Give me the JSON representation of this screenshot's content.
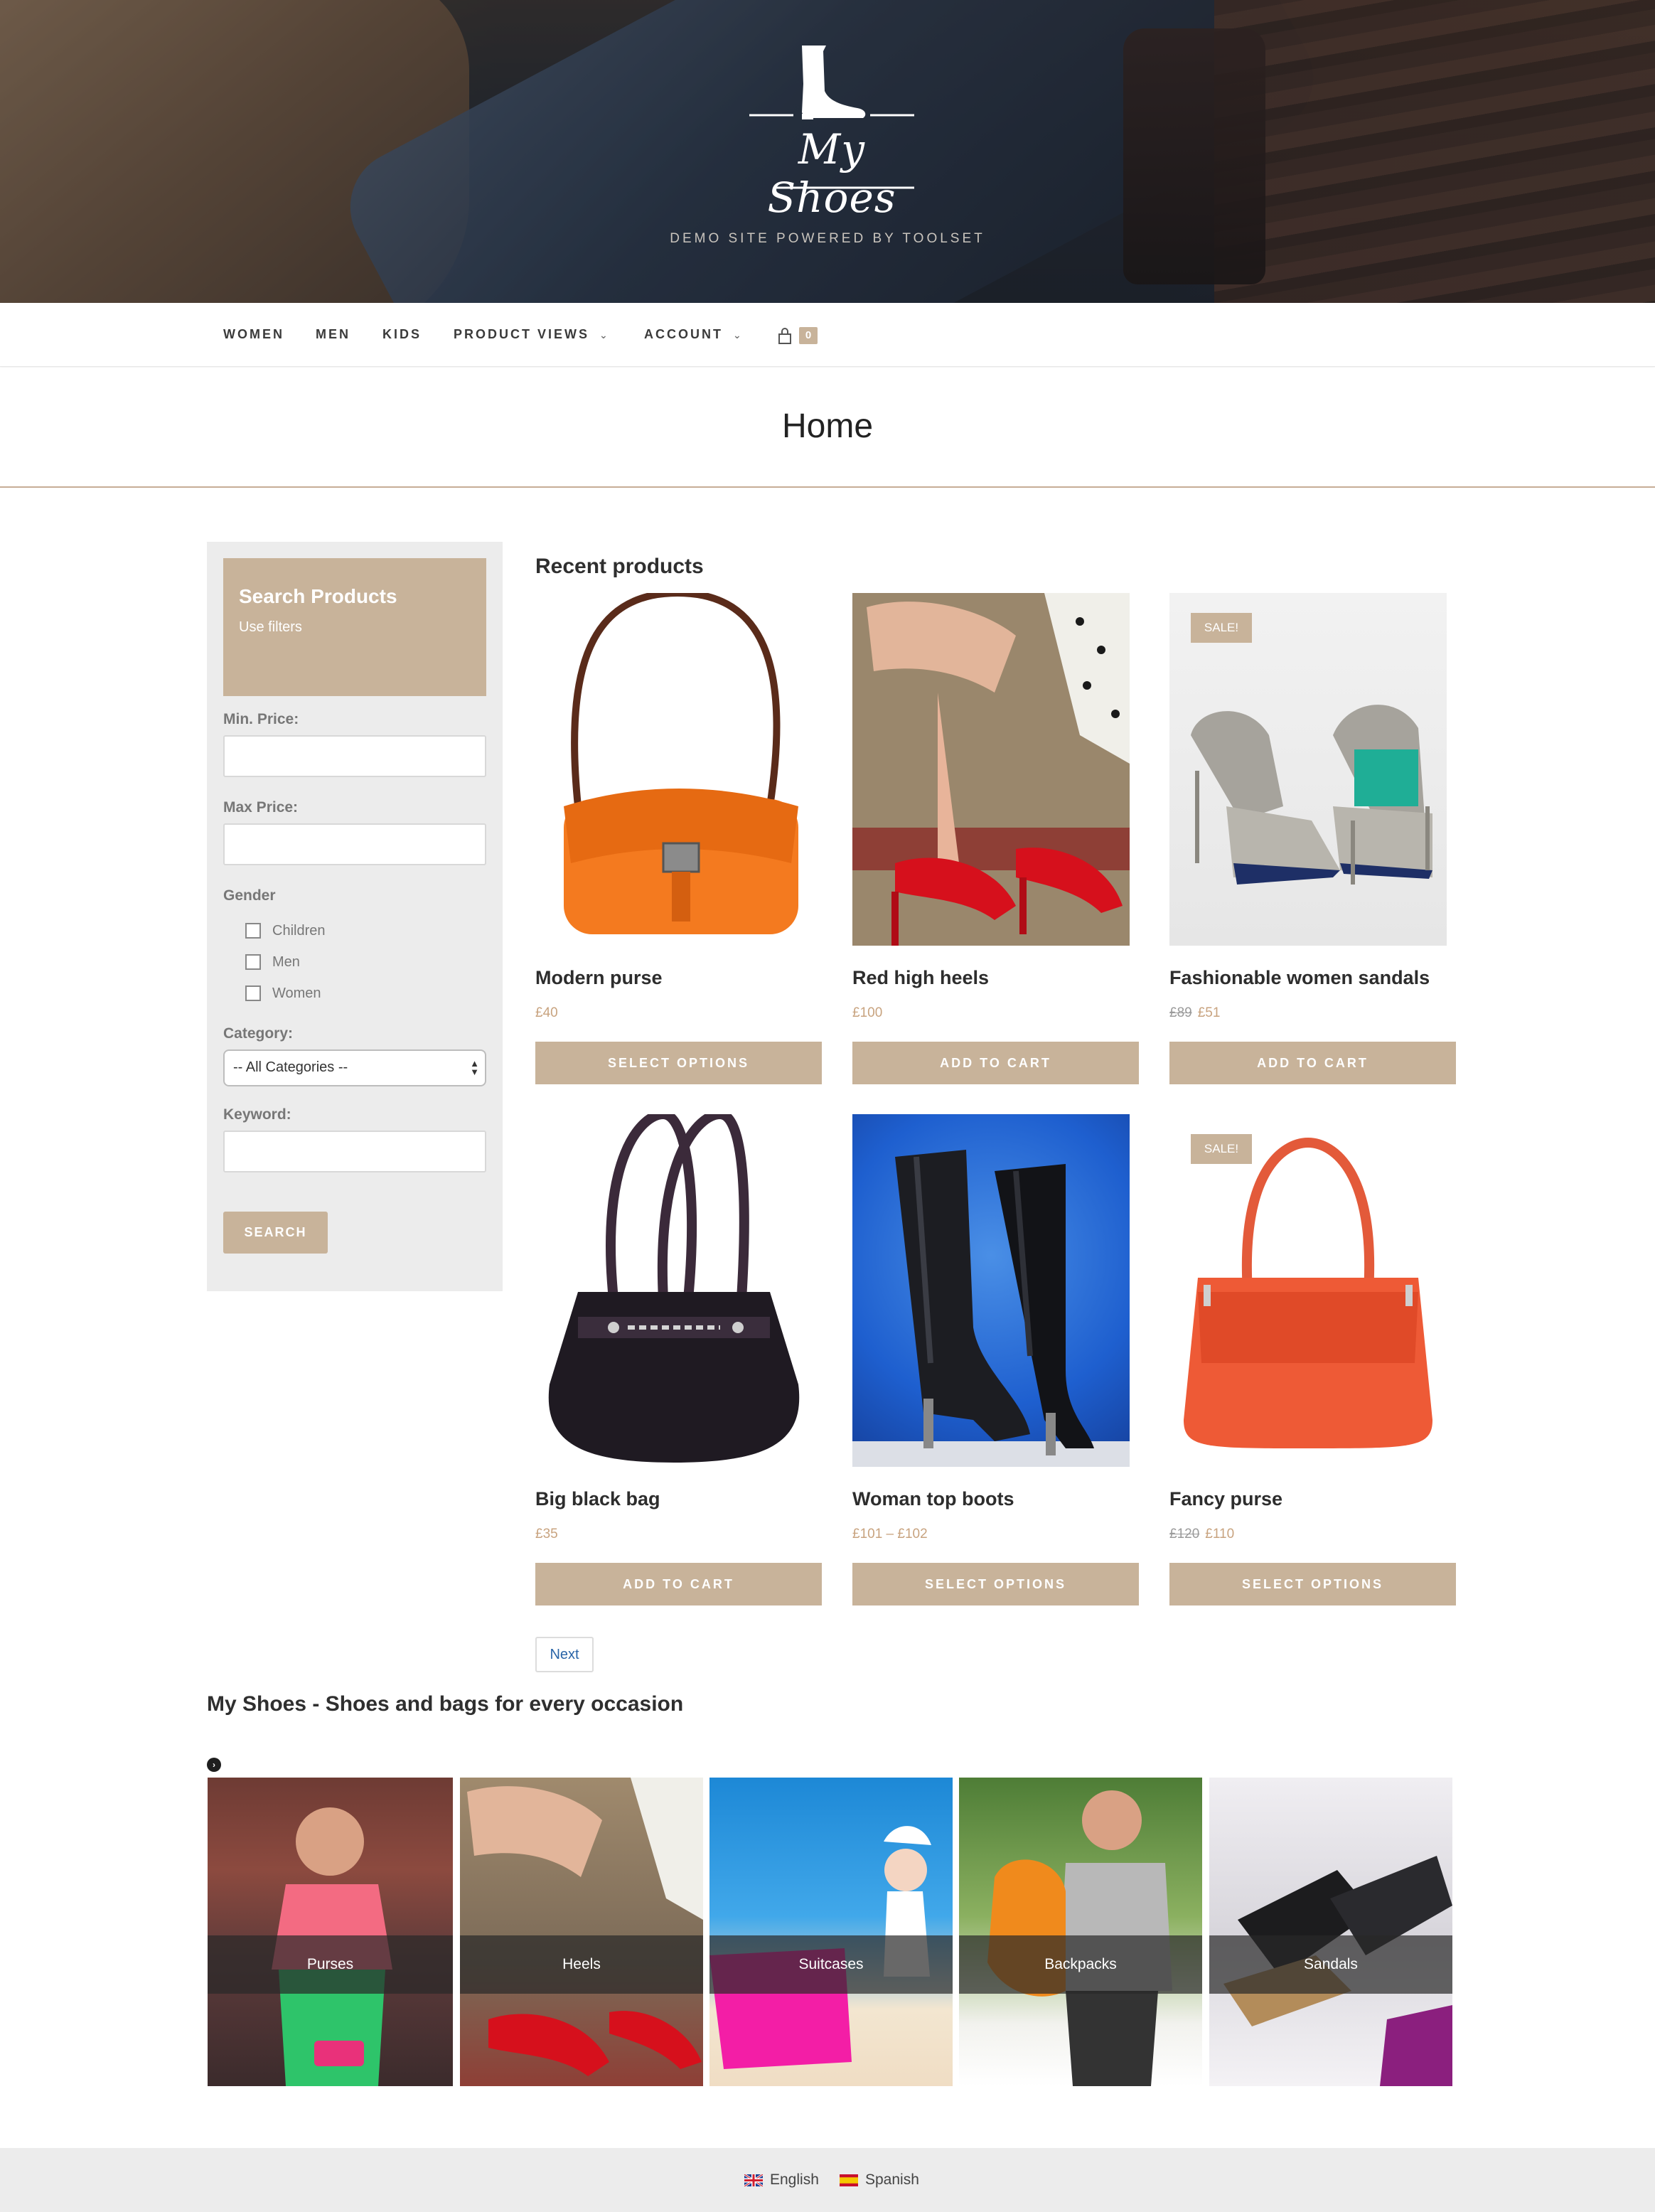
{
  "site": {
    "logo_text": "My Shoes",
    "tagline": "DEMO SITE POWERED BY TOOLSET"
  },
  "nav": {
    "items": [
      {
        "label": "WOMEN"
      },
      {
        "label": "MEN"
      },
      {
        "label": "KIDS"
      },
      {
        "label": "PRODUCT VIEWS"
      },
      {
        "label": "ACCOUNT"
      }
    ],
    "dropdown_icon": "chevron-down-icon",
    "cart_icon": "shopping-bag-icon",
    "cart_count": "0"
  },
  "page": {
    "title": "Home"
  },
  "search": {
    "heading": "Search Products",
    "subheading": "Use filters",
    "min_price_label": "Min. Price:",
    "min_price_value": "",
    "max_price_label": "Max Price:",
    "max_price_value": "",
    "gender_label": "Gender",
    "gender_options": [
      {
        "label": "Children",
        "checked": false
      },
      {
        "label": "Men",
        "checked": false
      },
      {
        "label": "Women",
        "checked": false
      }
    ],
    "category_label": "Category:",
    "category_selected": "-- All Categories --",
    "keyword_label": "Keyword:",
    "keyword_value": "",
    "button_label": "SEARCH"
  },
  "products": {
    "section_title": "Recent products",
    "items": [
      {
        "name": "Modern purse",
        "price": "£40",
        "old_price": "",
        "sale": false,
        "button": "SELECT OPTIONS",
        "image": "orange-handbag"
      },
      {
        "name": "Red high heels",
        "price": "£100",
        "old_price": "",
        "sale": false,
        "button": "ADD TO CART",
        "image": "red-heels"
      },
      {
        "name": "Fashionable women sandals",
        "price": "£51",
        "old_price": "£89",
        "sale": true,
        "button": "ADD TO CART",
        "image": "grey-teal-sandals"
      },
      {
        "name": "Big black bag",
        "price": "£35",
        "old_price": "",
        "sale": false,
        "button": "ADD TO CART",
        "image": "black-bag"
      },
      {
        "name": "Woman top boots",
        "price": "£101 – £102",
        "old_price": "",
        "sale": false,
        "button": "SELECT OPTIONS",
        "image": "black-boots"
      },
      {
        "name": "Fancy purse",
        "price": "£110",
        "old_price": "£120",
        "sale": true,
        "button": "SELECT OPTIONS",
        "image": "red-purse"
      }
    ],
    "sale_badge": "SALE!",
    "next_label": "Next"
  },
  "categories": {
    "title": "My Shoes - Shoes and bags for every occasion",
    "arrow_icon": "circle-arrow-right-icon",
    "items": [
      {
        "label": "Purses"
      },
      {
        "label": "Heels"
      },
      {
        "label": "Suitcases"
      },
      {
        "label": "Backpacks"
      },
      {
        "label": "Sandals"
      }
    ]
  },
  "footer": {
    "languages": [
      {
        "label": "English",
        "flag": "uk-flag-icon"
      },
      {
        "label": "Spanish",
        "flag": "spain-flag-icon"
      }
    ]
  },
  "colors": {
    "accent": "#c8b39a",
    "price": "#c8a37f",
    "link": "#2a65a8",
    "sidebar_bg": "#ececec"
  }
}
